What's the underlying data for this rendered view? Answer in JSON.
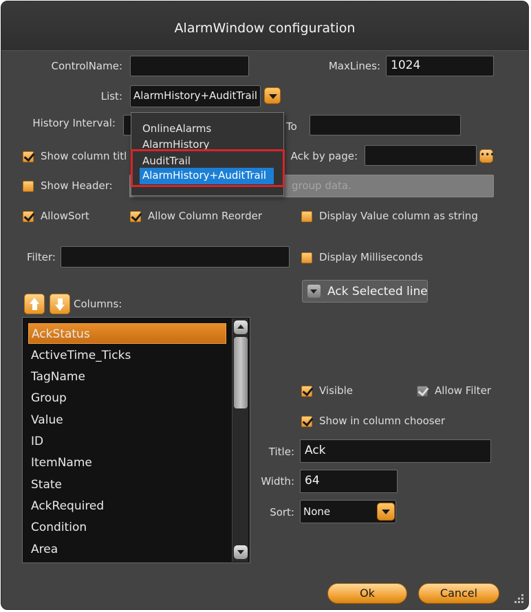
{
  "window": {
    "title": "AlarmWindow configuration"
  },
  "fields": {
    "control_name": {
      "label": "ControlName:",
      "value": ""
    },
    "max_lines": {
      "label": "MaxLines:",
      "value": "1024"
    },
    "list": {
      "label": "List:",
      "value": "AlarmHistory+AuditTrail"
    },
    "history_interval": {
      "label": "History Interval:",
      "to_label": "To",
      "to_value": ""
    },
    "ack_by_page": {
      "label": "Ack by page:",
      "value": ""
    },
    "header_text": {
      "value": "group data."
    },
    "filter": {
      "label": "Filter:",
      "value": ""
    }
  },
  "list_dropdown": {
    "options": [
      "OnlineAlarms",
      "AlarmHistory",
      "AuditTrail",
      "AlarmHistory+AuditTrail"
    ],
    "selected": "AlarmHistory+AuditTrail"
  },
  "checkboxes": {
    "show_column_title": {
      "label": "Show column titl",
      "checked": true
    },
    "show_header": {
      "label": "Show Header:",
      "checked": false
    },
    "allow_sort": {
      "label": "AllowSort",
      "checked": true
    },
    "allow_column_reorder": {
      "label": "Allow Column Reorder",
      "checked": true
    },
    "display_value_as_string": {
      "label": "Display Value column as string",
      "checked": false
    },
    "display_milliseconds": {
      "label": "Display Milliseconds",
      "checked": false
    },
    "visible": {
      "label": "Visible",
      "checked": true
    },
    "allow_filter": {
      "label": "Allow Filter",
      "checked": true
    },
    "show_in_column_chooser": {
      "label": "Show in column chooser",
      "checked": true
    }
  },
  "ack_selected_button": {
    "label": "Ack Selected line"
  },
  "columns": {
    "label": "Columns:",
    "items": [
      "AckStatus",
      "ActiveTime_Ticks",
      "TagName",
      "Group",
      "Value",
      "ID",
      "ItemName",
      "State",
      "AckRequired",
      "Condition",
      "Area"
    ],
    "selected": "AckStatus"
  },
  "column_props": {
    "title_label": "Title:",
    "title_value": "Ack",
    "width_label": "Width:",
    "width_value": "64",
    "sort_label": "Sort:",
    "sort_value": "None"
  },
  "footer": {
    "ok_label": "Ok",
    "cancel_label": "Cancel"
  }
}
